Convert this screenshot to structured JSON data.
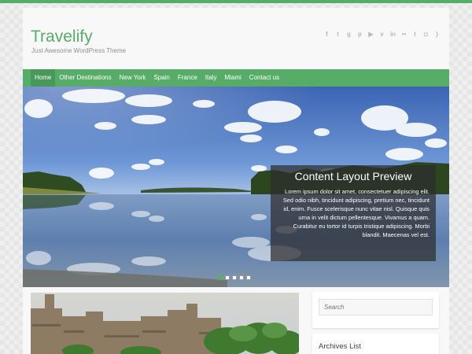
{
  "site": {
    "title": "Travelify",
    "tagline": "Just Awesome WordPress Theme"
  },
  "social_icons": [
    {
      "icon": "facebook-icon",
      "glyph": "f"
    },
    {
      "icon": "twitter-icon",
      "glyph": "t"
    },
    {
      "icon": "google-plus-icon",
      "glyph": "g"
    },
    {
      "icon": "pinterest-icon",
      "glyph": "p"
    },
    {
      "icon": "youtube-icon",
      "glyph": "▶"
    },
    {
      "icon": "vimeo-icon",
      "glyph": "v"
    },
    {
      "icon": "linkedin-icon",
      "glyph": "in"
    },
    {
      "icon": "flickr-icon",
      "glyph": "••"
    },
    {
      "icon": "tumblr-icon",
      "glyph": "t"
    },
    {
      "icon": "instagram-icon",
      "glyph": "◘"
    },
    {
      "icon": "rss-icon",
      "glyph": ")"
    }
  ],
  "nav": {
    "items": [
      "Home",
      "Other Destinations",
      "New York",
      "Spain",
      "France",
      "Italy",
      "Miami",
      "Contact us"
    ],
    "active_index": 0
  },
  "slider": {
    "title": "Content Layout Preview",
    "text": "Lorem ipsum dolor sit amet, consectetuer adipiscing elit. Sed odio nibh, tincidunt adipiscing, pretium nec, tincidunt id, enim. Fusce scelerisque nunc vitae nisl. Quisque quis urna in velit dictum pellentesque. Vivamus a quam. Curabitur eu tortor id turpis tristique adipiscing. Morbi blandit. Maecenas vel est.",
    "dot_count": 5,
    "active_dot": 0
  },
  "sidebar": {
    "search_placeholder": "Search",
    "archives_title": "Archives List"
  },
  "colors": {
    "accent": "#57ad68",
    "accent_dark": "#48985a"
  }
}
